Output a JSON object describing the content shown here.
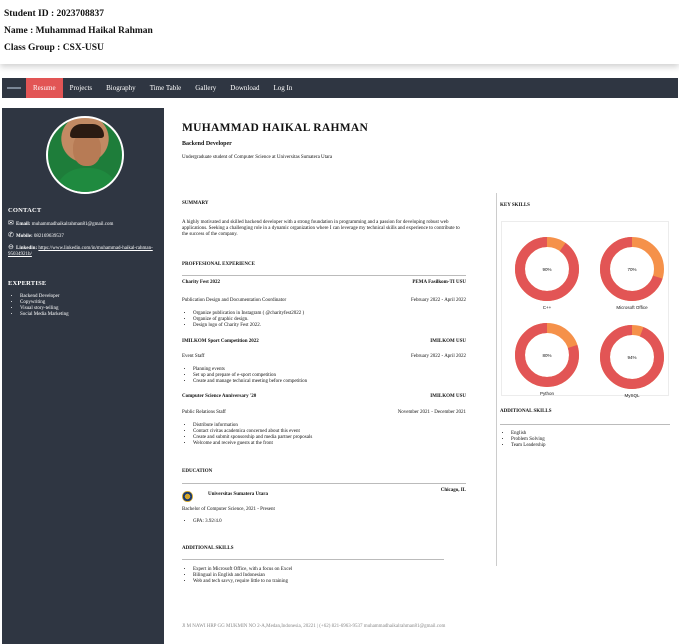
{
  "header": {
    "student_id_label": "Student ID : ",
    "student_id": "2023708837",
    "name_label": "Name : ",
    "name": "Muhammad Haikal Rahman",
    "class_label": "Class Group : ",
    "class_group": "CSX-USU"
  },
  "nav": {
    "items": [
      "Resume",
      "Projects",
      "Biography",
      "Time Table",
      "Gallery",
      "Download",
      "Log In"
    ],
    "active": "Resume"
  },
  "sidebar": {
    "contact_title": "CONTACT",
    "email_label": "Email:",
    "email": "muhammadhaikalrahman81@gmail.com",
    "mobile_label": "Mobile:",
    "mobile": "082169639537",
    "linkedin_label": "Linkedin:",
    "linkedin": "https://www.linkedin.com/in/muhammad-haikal-rahman-95034921b/",
    "expertise_title": "EXPERTISE",
    "expertise": [
      "Backend Developer",
      "Copywriting",
      "Visual story-telling",
      "Social Media Marketing"
    ]
  },
  "main": {
    "name": "MUHAMMAD HAIKAL RAHMAN",
    "role": "Backend Developer",
    "tagline": "Undergraduate student of Computer Science at Universitas Sumatera Utara",
    "summary_title": "SUMMARY",
    "summary": "A highly motivated and skilled backend developer with a strong foundation in programming and a passion for developing robust web applications. Seeking a challenging role in a dynamic organization where I can leverage my technical skills and experience to contribute to the success of the company.",
    "experience_title": "PROFFESIONAL EXPERIENCE",
    "experience": [
      {
        "event": "Charity Fest 2022",
        "org": "PEMA Fasilkom-TI USU",
        "position": "Publication Design and Documentation Coordinator",
        "period": "February 2022 - April 2022",
        "tasks": [
          "Organize publication in Instagram ( @charityfest2022 )",
          "Organize of graphic design.",
          "Design logo of Charity Fest 2022."
        ]
      },
      {
        "event": "IMILKOM Sport Competition 2022",
        "org": "IMILKOM USU",
        "position": "Event Staff",
        "period": "February 2022 - April 2022",
        "tasks": [
          "Planning events",
          "Set up and prepare of e-sport competition",
          "Create and manage technical meeting before competition"
        ]
      },
      {
        "event": "Computer Science Anniversary '20",
        "org": "IMILKOM USU",
        "position": "Public Relations Staff",
        "period": "November 2021 - December 2021",
        "tasks": [
          "Distribute information",
          "Contact civitas academica concerned about this event",
          "Create and submit sponsorship and media partner proposals",
          "Welcome and receive guests at the front"
        ]
      }
    ],
    "education_title": "EDUCATION",
    "education": {
      "school": "Universitas Sumatera Utara",
      "location": "Chicago, IL",
      "degree": "Bachelor of Computer Science, 2021 - Present",
      "gpa": "GPA: 3.92/4.0"
    },
    "additional_title": "ADDITIONAL SKILLS",
    "additional": [
      "Expert in Microsoft Office, with a focus on Excel",
      "Bilingual in English and Indonesian",
      "Web and tech savvy, require little to no training"
    ]
  },
  "right": {
    "key_skills_title": "KEY SKILLS",
    "skills": [
      {
        "label": "C++",
        "percent": 90,
        "text": "90%"
      },
      {
        "label": "Microsoft Office",
        "percent": 70,
        "text": "70%"
      },
      {
        "label": "Python",
        "percent": 80,
        "text": "80%"
      },
      {
        "label": "MySQL",
        "percent": 94,
        "text": "94%"
      }
    ],
    "additional_title": "ADDITIONAL SKILLS",
    "additional": [
      "English",
      "Problem Solving",
      "Team Leadership"
    ]
  },
  "colors": {
    "navbar": "#2f3642",
    "active_tab": "#e25555",
    "donut_fill": "#e25555",
    "donut_rest": "#f5914a"
  },
  "footer": "Jl M NAWI HRP GG MUKMIN NO 2-A,Medan,Indonesia, 20221 | (+62) 821-6963-9537 muhammadhaikalrahman81@gmail.com"
}
